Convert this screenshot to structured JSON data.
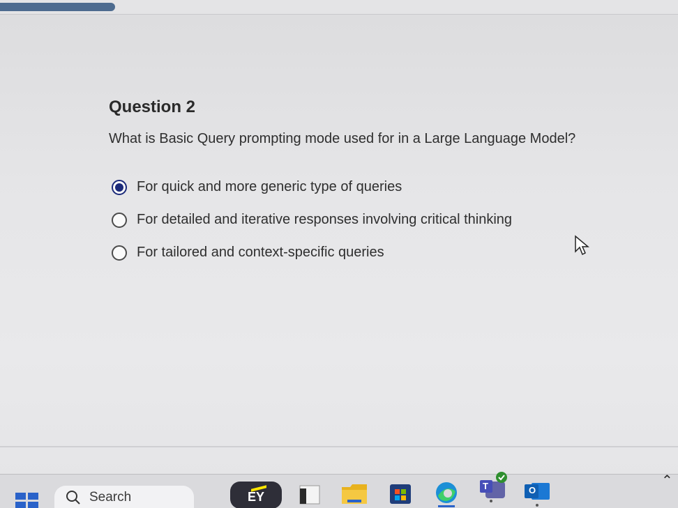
{
  "progress": {
    "fraction": 0.17
  },
  "question": {
    "title": "Question 2",
    "text": "What is Basic Query prompting mode used for in a Large Language Model?",
    "options": [
      {
        "label": "For quick and more generic type of queries",
        "selected": true
      },
      {
        "label": "For detailed and iterative responses involving critical thinking",
        "selected": false
      },
      {
        "label": "For tailored and context-specific queries",
        "selected": false
      }
    ]
  },
  "taskbar": {
    "search_label": "Search",
    "ey_label": "EY",
    "teams_letter": "T",
    "outlook_letter": "O",
    "icons": [
      "windows-start-icon",
      "search-icon",
      "ey-app-icon",
      "file-viewer-icon",
      "file-explorer-icon",
      "microsoft-store-icon",
      "edge-icon",
      "teams-icon",
      "outlook-icon",
      "chevron-up-icon"
    ]
  },
  "colors": {
    "accent": "#1b2a7a",
    "progress": "#4d6b8f",
    "windows_blue": "#2a62c9",
    "ey_yellow": "#ffe600"
  }
}
